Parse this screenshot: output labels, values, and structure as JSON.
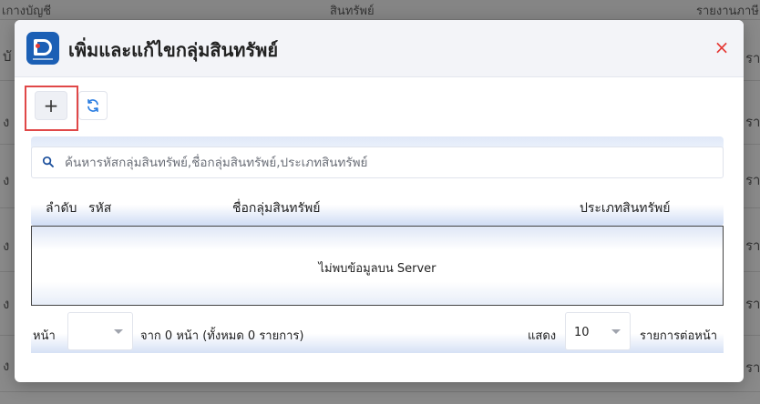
{
  "background": {
    "columns": [
      "เกางบัญชี",
      "สินทรัพย์",
      "รายงานภาษี"
    ],
    "row_edge_left": [
      "บั",
      "ง",
      "ง",
      "ง",
      "ง",
      "ง",
      "ง"
    ],
    "row_edge_right": [
      "รา",
      "ราย",
      "ราย",
      "ราย",
      "ราย",
      "ราย",
      "ราย"
    ]
  },
  "modal": {
    "title": "เพิ่มและแก้ไขกลุ่มสินทรัพย์",
    "close_label": "×",
    "add_label": "+",
    "search": {
      "value": "",
      "placeholder": "ค้นหารหัสกลุ่มสินทรัพย์,ชื่อกลุ่มสินทรัพย์,ประเภทสินทรัพย์"
    },
    "table": {
      "headers": [
        "ลำดับ",
        "รหัส",
        "ชื่อกลุ่มสินทรัพย์",
        "ประเภทสินทรัพย์"
      ],
      "empty_message": "ไม่พบข้อมูลบน Server"
    },
    "pager": {
      "page_label": "หน้า",
      "page_value": "",
      "summary": "จาก 0 หน้า (ทั้งหมด 0 รายการ)",
      "show_label": "แสดง",
      "page_size": "10",
      "per_page_label": "รายการต่อหน้า"
    }
  },
  "icons": {
    "logo": "app-logo-icon",
    "search": "search-icon",
    "refresh": "refresh-icon",
    "close": "close-icon",
    "chevron": "chevron-down-icon"
  },
  "colors": {
    "accent": "#1b5fb5",
    "close": "#e53935",
    "highlight": "#e04848",
    "refresh": "#2a7de1"
  }
}
